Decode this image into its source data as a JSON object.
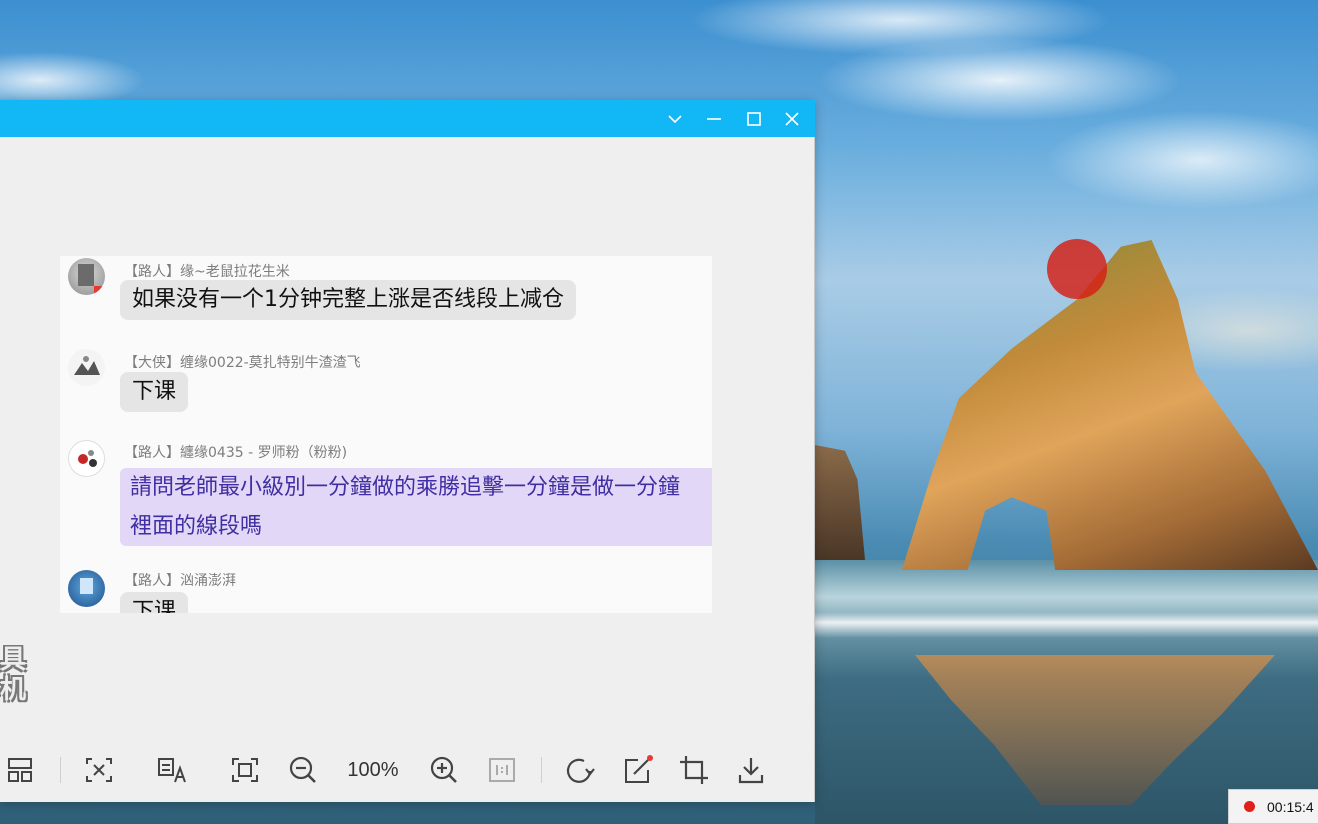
{
  "colors": {
    "titlebar": "#12b7f5",
    "window_bg": "#efefef",
    "bubble_gray": "#e5e5e5",
    "bubble_highlight": "#e3d7f7",
    "highlight_text": "#3f2fa2",
    "record_dot": "#e0201a"
  },
  "window": {
    "controls": {
      "dropdown": "chevron-down-icon",
      "minimize": "minimize-icon",
      "maximize": "maximize-icon",
      "close": "close-icon"
    }
  },
  "chat": {
    "messages": [
      {
        "sender": "【路人】缘~老鼠拉花生米",
        "text": "如果没有一个1分钟完整上涨是否线段上减仓",
        "highlighted": false
      },
      {
        "sender": "【大侠】缠缘0022-莫扎特别牛渣渣飞",
        "text": "下课",
        "highlighted": false
      },
      {
        "sender": "【路人】纏缘0435 - 罗师粉（粉粉)",
        "text_line1": "請問老師最小級別一分鐘做的乘勝追擊一分鐘是做一分鐘",
        "text_line2": "裡面的線段嗎",
        "highlighted": true
      },
      {
        "sender": "【路人】汹涌澎湃",
        "text": "下课",
        "highlighted": false
      }
    ]
  },
  "watermark": {
    "line1": "具",
    "line2": "机"
  },
  "toolbar": {
    "zoom_label": "100%",
    "tools": [
      "layout-icon",
      "text-recognize-icon",
      "translate-icon",
      "fit-screen-icon",
      "zoom-out-icon",
      "zoom-in-icon",
      "actual-size-icon",
      "rotate-icon",
      "edit-icon",
      "crop-icon",
      "download-icon"
    ]
  },
  "recording": {
    "time": "00:15:4"
  }
}
